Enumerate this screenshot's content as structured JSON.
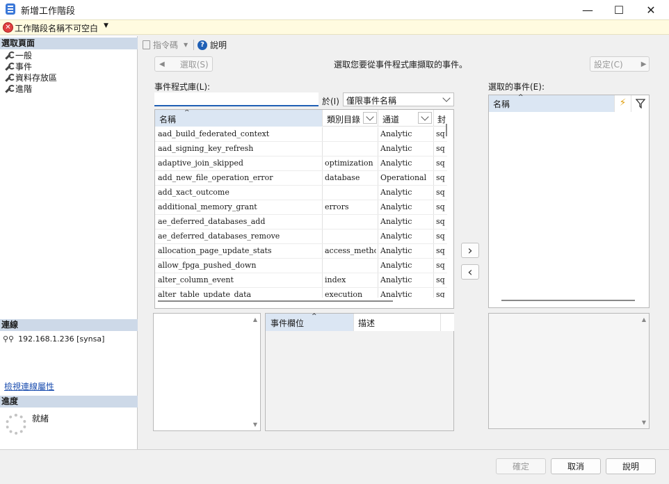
{
  "window": {
    "title": "新增工作階段",
    "minimize": "—",
    "maximize": "☐",
    "close": "✕"
  },
  "error_bar": {
    "message": "工作階段名稱不可空白",
    "icon": "error-icon"
  },
  "left_panel": {
    "select_page_header": "選取頁面",
    "pages": [
      {
        "label": "一般",
        "icon": "wrench-icon"
      },
      {
        "label": "事件",
        "icon": "wrench-icon"
      },
      {
        "label": "資料存放區",
        "icon": "wrench-icon"
      },
      {
        "label": "進階",
        "icon": "wrench-icon"
      }
    ],
    "connection_header": "連線",
    "connection_server": "192.168.1.236 [synsa]",
    "connection_link": "檢視連線屬性",
    "progress_header": "進度",
    "progress_status": "就緒"
  },
  "toolbar": {
    "script_label": "指令碼",
    "help_label": "說明"
  },
  "events_page": {
    "select_button": "選取(S)",
    "instruction": "選取您要從事件程式庫擷取的事件。",
    "configure_button": "設定(C)",
    "library_label": "事件程式庫(L):",
    "search_value": "",
    "in_label": "於(I)",
    "scope_value": "僅限事件名稱",
    "columns": {
      "name": "名稱",
      "category": "類別目錄",
      "channel": "通道",
      "package": "封"
    },
    "events": [
      {
        "name": "aad_build_federated_context",
        "category": "",
        "channel": "Analytic",
        "package": "sq"
      },
      {
        "name": "aad_signing_key_refresh",
        "category": "",
        "channel": "Analytic",
        "package": "sq"
      },
      {
        "name": "adaptive_join_skipped",
        "category": "optimization",
        "channel": "Analytic",
        "package": "sq"
      },
      {
        "name": "add_new_file_operation_error",
        "category": "database",
        "channel": "Operational",
        "package": "sq"
      },
      {
        "name": "add_xact_outcome",
        "category": "",
        "channel": "Analytic",
        "package": "sq"
      },
      {
        "name": "additional_memory_grant",
        "category": "errors",
        "channel": "Analytic",
        "package": "sq"
      },
      {
        "name": "ae_deferred_databases_add",
        "category": "",
        "channel": "Analytic",
        "package": "sq"
      },
      {
        "name": "ae_deferred_databases_remove",
        "category": "",
        "channel": "Analytic",
        "package": "sq"
      },
      {
        "name": "allocation_page_update_stats",
        "category": "access_methods",
        "channel": "Analytic",
        "package": "sq"
      },
      {
        "name": "allow_fpga_pushed_down",
        "category": "",
        "channel": "Analytic",
        "package": "sq"
      },
      {
        "name": "alter_column_event",
        "category": "index",
        "channel": "Analytic",
        "package": "sq"
      },
      {
        "name": "alter_table_update_data",
        "category": "execution",
        "channel": "Analytic",
        "package": "sq"
      }
    ],
    "event_fields_columns": {
      "field": "事件欄位",
      "description": "描述"
    },
    "selected_label": "選取的事件(E):",
    "selected_column": "名稱",
    "add_arrow": "›",
    "remove_arrow": "‹"
  },
  "footer": {
    "ok": "確定",
    "cancel": "取消",
    "help": "說明"
  }
}
